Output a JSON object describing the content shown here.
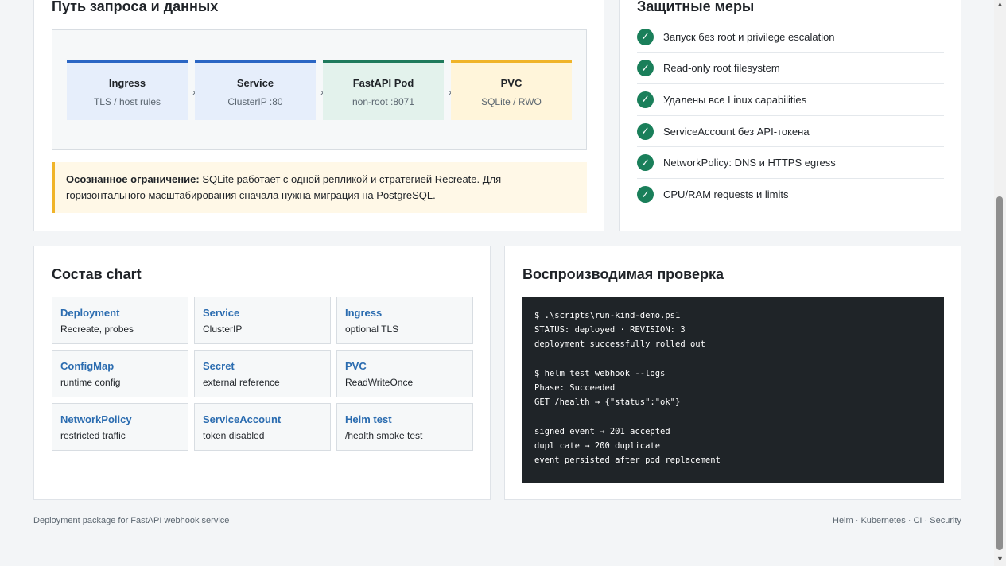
{
  "path_card": {
    "title": "Путь запроса и данных",
    "steps": [
      {
        "name": "Ingress",
        "sub": "TLS / host rules",
        "color": "#2b66c4",
        "bg": "#e6eefb"
      },
      {
        "name": "Service",
        "sub": "ClusterIP :80",
        "color": "#2b66c4",
        "bg": "#e6eefb"
      },
      {
        "name": "FastAPI Pod",
        "sub": "non-root :8071",
        "color": "#1f7a5c",
        "bg": "#e3f2ec"
      },
      {
        "name": "PVC",
        "sub": "SQLite / RWO",
        "color": "#f0b429",
        "bg": "#fff5da"
      }
    ],
    "arrow": "›",
    "note_strong": "Осознанное ограничение:",
    "note_text": " SQLite работает с одной репликой и стратегией Recreate. Для горизонтального масштабирования сначала нужна миграция на PostgreSQL."
  },
  "security_card": {
    "title": "Защитные меры",
    "check_glyph": "✓",
    "items": [
      "Запуск без root и privilege escalation",
      "Read-only root filesystem",
      "Удалены все Linux capabilities",
      "ServiceAccount без API-токена",
      "NetworkPolicy: DNS и HTTPS egress",
      "CPU/RAM requests и limits"
    ]
  },
  "chart_card": {
    "title": "Состав chart",
    "items": [
      {
        "title": "Deployment",
        "desc": "Recreate, probes"
      },
      {
        "title": "Service",
        "desc": "ClusterIP"
      },
      {
        "title": "Ingress",
        "desc": "optional TLS"
      },
      {
        "title": "ConfigMap",
        "desc": "runtime config"
      },
      {
        "title": "Secret",
        "desc": "external reference"
      },
      {
        "title": "PVC",
        "desc": "ReadWriteOnce"
      },
      {
        "title": "NetworkPolicy",
        "desc": "restricted traffic"
      },
      {
        "title": "ServiceAccount",
        "desc": "token disabled"
      },
      {
        "title": "Helm test",
        "desc": "/health smoke test"
      }
    ]
  },
  "check_card": {
    "title": "Воспроизводимая проверка",
    "lines": [
      "$ .\\scripts\\run-kind-demo.ps1",
      "STATUS: deployed · REVISION: 3",
      "deployment successfully rolled out",
      "",
      "$ helm test webhook --logs",
      "Phase: Succeeded",
      "GET /health → {\"status\":\"ok\"}",
      "",
      "signed event → 201 accepted",
      "duplicate → 200 duplicate",
      "event persisted after pod replacement"
    ]
  },
  "footer": {
    "left": "Deployment package for FastAPI webhook service",
    "right": "Helm · Kubernetes · CI · Security"
  },
  "scrollbar": {
    "up": "▲",
    "down": "▼"
  }
}
